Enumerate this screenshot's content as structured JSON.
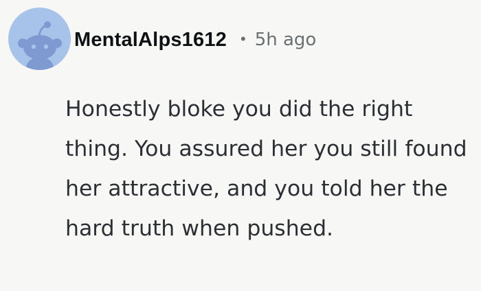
{
  "comment": {
    "avatar_icon": "reddit-snoo-icon",
    "username": "MentalAlps1612",
    "separator": "•",
    "timestamp": "5h ago",
    "body": "Honestly bloke you did the right thing. You assured her you still found her attractive, and you told her the hard truth when pushed."
  },
  "colors": {
    "background": "#f7f7f6",
    "avatar_bg": "#a7c3ea",
    "avatar_figure": "#7e9ad0",
    "username": "#0e1113",
    "meta": "#6a6f73",
    "body_text": "#2b2f33"
  }
}
